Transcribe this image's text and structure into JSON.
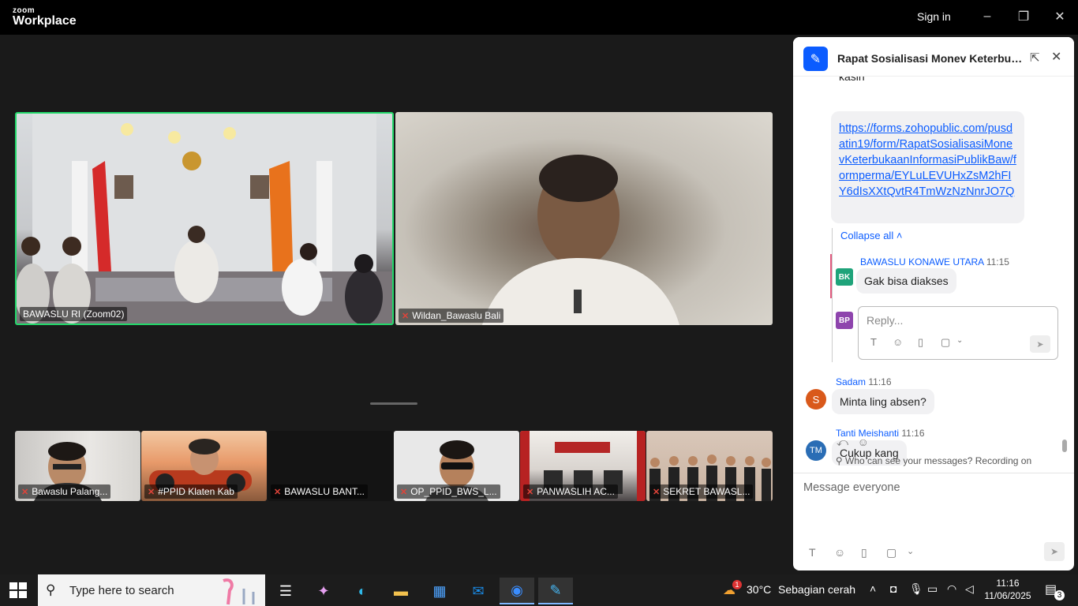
{
  "titlebar": {
    "logo_top": "zoom",
    "logo_main": "Workplace",
    "sign_in": "Sign in"
  },
  "window_controls": {
    "minimize": "–",
    "restore": "❐",
    "close": "✕"
  },
  "participants": {
    "main": [
      {
        "name": "BAWASLU RI (Zoom02)",
        "muted": false
      },
      {
        "name": "Wildan_Bawaslu Bali",
        "muted": true
      }
    ],
    "thumbnails": [
      {
        "name": "Bawaslu Palang...",
        "muted": true
      },
      {
        "name": "#PPID Klaten Kab",
        "muted": true
      },
      {
        "name": "BAWASLU BANT...",
        "muted": true
      },
      {
        "name": "OP_PPID_BWS_L...",
        "muted": true
      },
      {
        "name": "PANWASLIH AC...",
        "muted": true
      },
      {
        "name": "SEKRET BAWASL...",
        "muted": true
      }
    ]
  },
  "chat": {
    "title": "Rapat Sosialisasi Monev Keterbukaa...",
    "link_partial_top": "kasih",
    "link": "https://forms.zohopublic.com/pusdatin19/form/RapatSosialisasiMonevKeterbukaanInformasiPublikBaw/formperma/EYLuLEVUHxZsM2hFIY6dIsXXtQvtR4TmWzNzNnrJO7Q",
    "collapse_label": "Collapse all ˄",
    "reply": {
      "avatar": "BK",
      "sender": "BAWASLU KONAWE UTARA",
      "time": "11:15",
      "text": "Gak bisa diakses"
    },
    "reply_box": {
      "avatar": "BP",
      "placeholder": "Reply..."
    },
    "messages": [
      {
        "avatar": "S",
        "sender": "Sadam",
        "time": "11:16",
        "text": "Minta ling absen?",
        "color": "#d9591b"
      },
      {
        "avatar": "TM",
        "sender": "Tanti Meishanti",
        "time": "11:16",
        "text": "Cukup kang",
        "color": "#2a6db5"
      }
    ],
    "who_can_see": "Who can see your messages? Recording on",
    "compose_placeholder": "Message everyone"
  },
  "taskbar": {
    "search_placeholder": "Type here to search",
    "weather_temp": "30°C",
    "weather_desc": "Sebagian cerah",
    "weather_badge": "1",
    "time": "11:16",
    "date": "11/06/2025",
    "notifications": "3"
  }
}
